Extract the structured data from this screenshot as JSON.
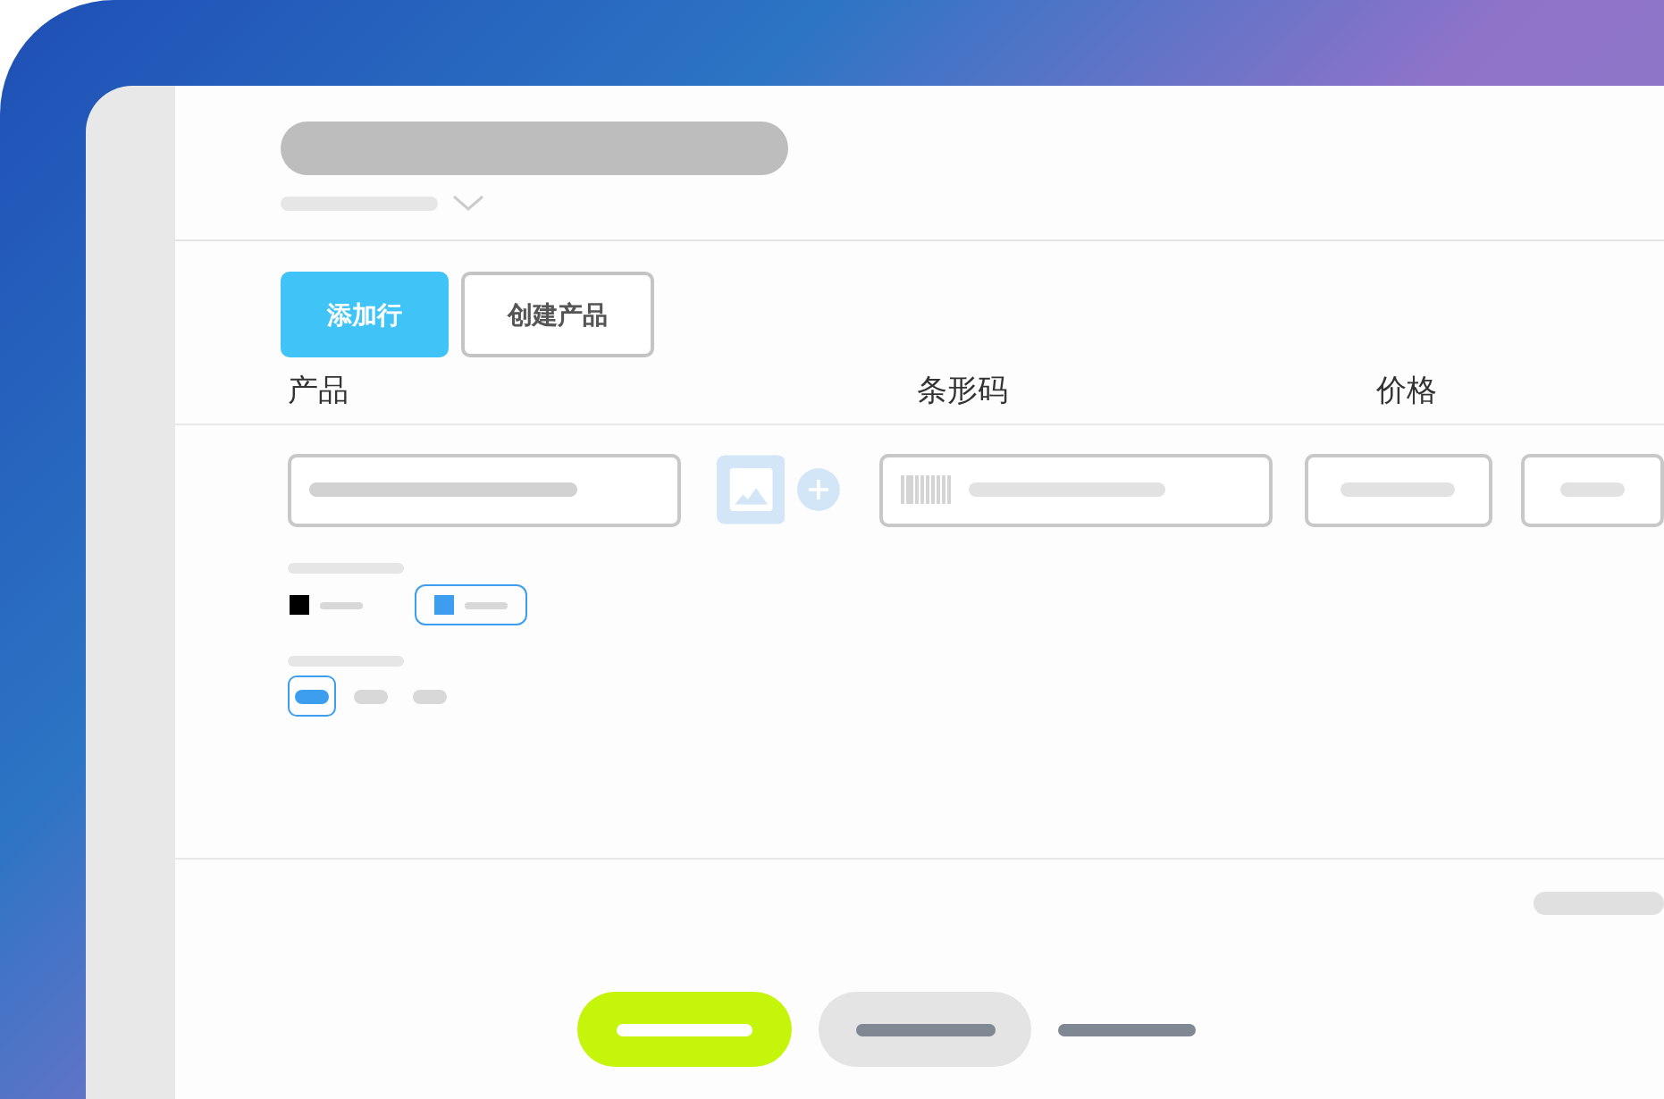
{
  "toolbar": {
    "buttons": [
      {
        "label": "添加行",
        "kind": "primary"
      },
      {
        "label": "创建产品",
        "kind": "secondary"
      }
    ]
  },
  "columns": [
    "产品",
    "条形码",
    "价格"
  ],
  "variants": {
    "colors": [
      {
        "color": "#000000",
        "selected": false
      },
      {
        "color": "#3d9ef0",
        "selected": true
      }
    ],
    "sizes": [
      {
        "selected": true
      },
      {
        "selected": false
      },
      {
        "selected": false
      }
    ]
  }
}
